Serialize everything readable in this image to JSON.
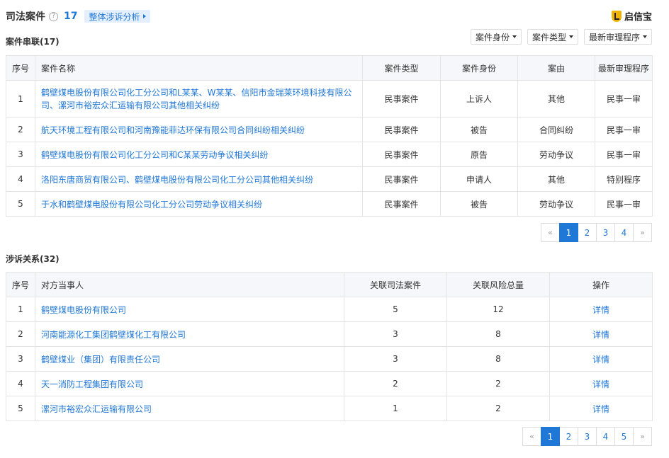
{
  "header": {
    "title": "司法案件",
    "count": "17",
    "analysis_label": "整体涉诉分析",
    "brand_name": "启信宝"
  },
  "cases": {
    "section_title": "案件串联(17)",
    "filters": [
      "案件身份",
      "案件类型",
      "最新审理程序"
    ],
    "columns": [
      "序号",
      "案件名称",
      "案件类型",
      "案件身份",
      "案由",
      "最新审理程序"
    ],
    "rows": [
      [
        "1",
        "鹤壁煤电股份有限公司化工分公司和L某某、W某某、信阳市金瑞莱环境科技有限公司、漯河市裕宏众汇运输有限公司其他相关纠纷",
        "民事案件",
        "上诉人",
        "其他",
        "民事一审"
      ],
      [
        "2",
        "航天环境工程有限公司和河南豫能菲达环保有限公司合同纠纷相关纠纷",
        "民事案件",
        "被告",
        "合同纠纷",
        "民事一审"
      ],
      [
        "3",
        "鹤壁煤电股份有限公司化工分公司和C某某劳动争议相关纠纷",
        "民事案件",
        "原告",
        "劳动争议",
        "民事一审"
      ],
      [
        "4",
        "洛阳东唐商贸有限公司、鹤壁煤电股份有限公司化工分公司其他相关纠纷",
        "民事案件",
        "申请人",
        "其他",
        "特别程序"
      ],
      [
        "5",
        "于水和鹤壁煤电股份有限公司化工分公司劳动争议相关纠纷",
        "民事案件",
        "被告",
        "劳动争议",
        "民事一审"
      ]
    ],
    "pager": {
      "prev": "«",
      "pages": [
        "1",
        "2",
        "3",
        "4"
      ],
      "next": "»",
      "current": "1"
    }
  },
  "relations": {
    "section_title": "涉诉关系(32)",
    "columns": [
      "序号",
      "对方当事人",
      "关联司法案件",
      "关联风险总量",
      "操作"
    ],
    "rows": [
      [
        "1",
        "鹤壁煤电股份有限公司",
        "5",
        "12",
        "详情"
      ],
      [
        "2",
        "河南能源化工集团鹤壁煤化工有限公司",
        "3",
        "8",
        "详情"
      ],
      [
        "3",
        "鹤壁煤业（集团）有限责任公司",
        "3",
        "8",
        "详情"
      ],
      [
        "4",
        "天一消防工程集团有限公司",
        "2",
        "2",
        "详情"
      ],
      [
        "5",
        "漯河市裕宏众汇运输有限公司",
        "1",
        "2",
        "详情"
      ]
    ],
    "pager": {
      "prev": "«",
      "pages": [
        "1",
        "2",
        "3",
        "4",
        "5"
      ],
      "next": "»",
      "current": "1"
    }
  },
  "colors": {
    "accent": "#1f77d6",
    "header_bg": "#f5f7fa",
    "border": "#e4e4e4",
    "tag_bg": "#e3efff"
  },
  "icons": {
    "help": "question-circle-icon",
    "brand": "qixinbao-logo-icon",
    "dropdown": "caret-down-icon",
    "analysis_arrow": "caret-right-icon"
  }
}
